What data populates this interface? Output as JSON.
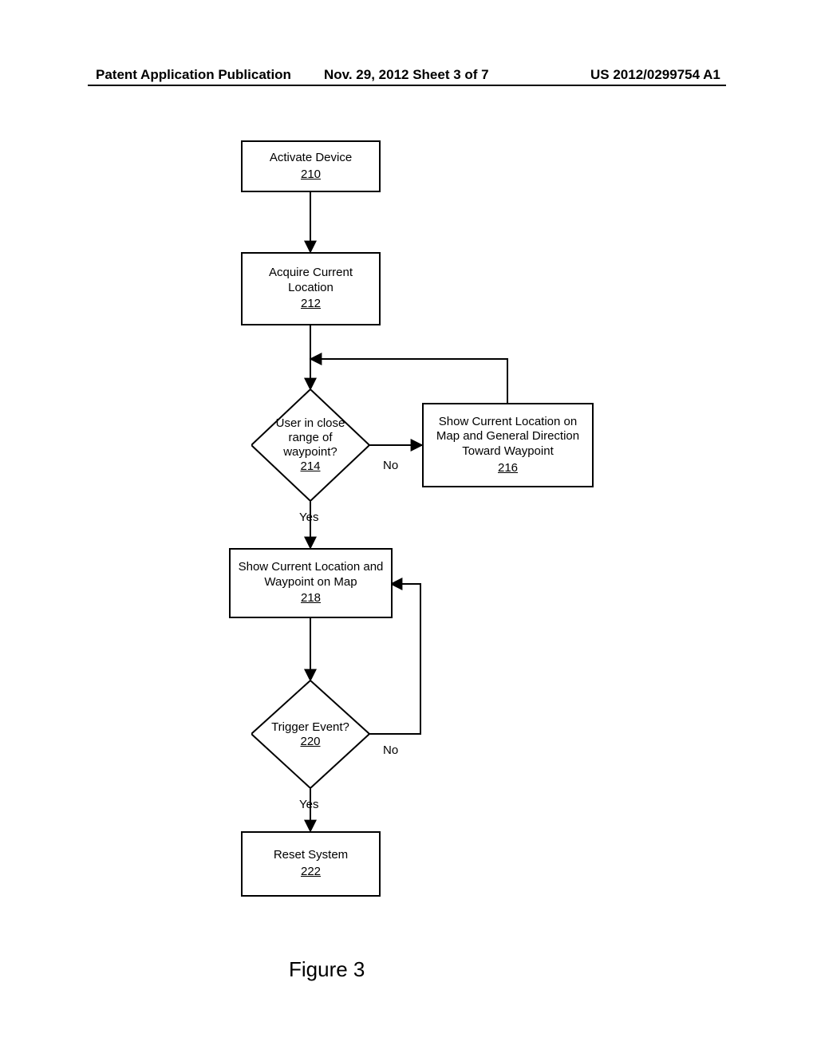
{
  "header": {
    "left": "Patent Application Publication",
    "mid": "Nov. 29, 2012  Sheet 3 of 7",
    "right": "US 2012/0299754 A1"
  },
  "nodes": {
    "n210": {
      "text": "Activate Device",
      "ref": "210"
    },
    "n212": {
      "text": "Acquire Current Location",
      "ref": "212"
    },
    "n214": {
      "text": "User in close range of waypoint?",
      "ref": "214"
    },
    "n216": {
      "text": "Show Current Location on Map and General Direction Toward Waypoint",
      "ref": "216"
    },
    "n218": {
      "text": "Show Current Location and Waypoint on Map",
      "ref": "218"
    },
    "n220": {
      "text": "Trigger Event?",
      "ref": "220"
    },
    "n222": {
      "text": "Reset System",
      "ref": "222"
    }
  },
  "labels": {
    "no1": "No",
    "yes1": "Yes",
    "no2": "No",
    "yes2": "Yes"
  },
  "figure": {
    "caption": "Figure 3"
  }
}
